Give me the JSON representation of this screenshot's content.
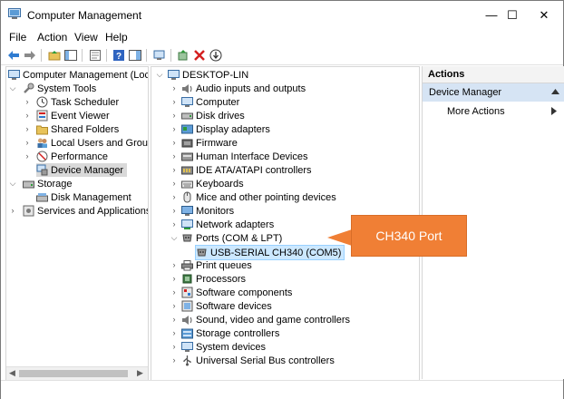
{
  "window": {
    "title": "Computer Management",
    "minimize_glyph": "—",
    "maximize_glyph": "☐",
    "close_glyph": "✕"
  },
  "menu": [
    "File",
    "Action",
    "View",
    "Help"
  ],
  "left_tree": {
    "root": "Computer Management (Local",
    "items": [
      {
        "label": "System Tools",
        "icon": "tools-icon",
        "level": 1,
        "expanded": true
      },
      {
        "label": "Task Scheduler",
        "icon": "clock-icon",
        "level": 2
      },
      {
        "label": "Event Viewer",
        "icon": "event-viewer-icon",
        "level": 2
      },
      {
        "label": "Shared Folders",
        "icon": "folder-icon",
        "level": 2
      },
      {
        "label": "Local Users and Groups",
        "icon": "users-icon",
        "level": 2
      },
      {
        "label": "Performance",
        "icon": "performance-icon",
        "level": 2
      },
      {
        "label": "Device Manager",
        "icon": "device-manager-icon",
        "level": 2,
        "selected": true
      },
      {
        "label": "Storage",
        "icon": "storage-icon",
        "level": 1,
        "expanded": true
      },
      {
        "label": "Disk Management",
        "icon": "disk-management-icon",
        "level": 2
      },
      {
        "label": "Services and Applications",
        "icon": "services-icon",
        "level": 1
      }
    ]
  },
  "device_tree": {
    "root": "DESKTOP-LIN",
    "items": [
      {
        "label": "Audio inputs and outputs",
        "icon": "speaker-icon"
      },
      {
        "label": "Computer",
        "icon": "computer-icon"
      },
      {
        "label": "Disk drives",
        "icon": "disk-drive-icon"
      },
      {
        "label": "Display adapters",
        "icon": "display-adapter-icon"
      },
      {
        "label": "Firmware",
        "icon": "firmware-icon"
      },
      {
        "label": "Human Interface Devices",
        "icon": "hid-icon"
      },
      {
        "label": "IDE ATA/ATAPI controllers",
        "icon": "ide-icon"
      },
      {
        "label": "Keyboards",
        "icon": "keyboard-icon"
      },
      {
        "label": "Mice and other pointing devices",
        "icon": "mouse-icon"
      },
      {
        "label": "Monitors",
        "icon": "monitor-icon"
      },
      {
        "label": "Network adapters",
        "icon": "network-icon"
      },
      {
        "label": "Ports (COM & LPT)",
        "icon": "port-icon",
        "expanded": true
      },
      {
        "label": "USB-SERIAL CH340 (COM5)",
        "icon": "serial-port-icon",
        "child": true,
        "selected": true
      },
      {
        "label": "Print queues",
        "icon": "printer-icon"
      },
      {
        "label": "Processors",
        "icon": "processor-icon"
      },
      {
        "label": "Software components",
        "icon": "software-component-icon"
      },
      {
        "label": "Software devices",
        "icon": "software-device-icon"
      },
      {
        "label": "Sound, video and game controllers",
        "icon": "sound-icon"
      },
      {
        "label": "Storage controllers",
        "icon": "storage-controller-icon"
      },
      {
        "label": "System devices",
        "icon": "system-device-icon"
      },
      {
        "label": "Universal Serial Bus controllers",
        "icon": "usb-icon"
      }
    ]
  },
  "actions": {
    "title": "Actions",
    "section": "Device Manager",
    "more": "More Actions"
  },
  "callout": {
    "text": "CH340 Port",
    "color": "#f07f35"
  },
  "colors": {
    "selection_gray": "#d9d9d9",
    "selection_blue": "#cce8ff",
    "actions_header": "#d6e4f4"
  }
}
